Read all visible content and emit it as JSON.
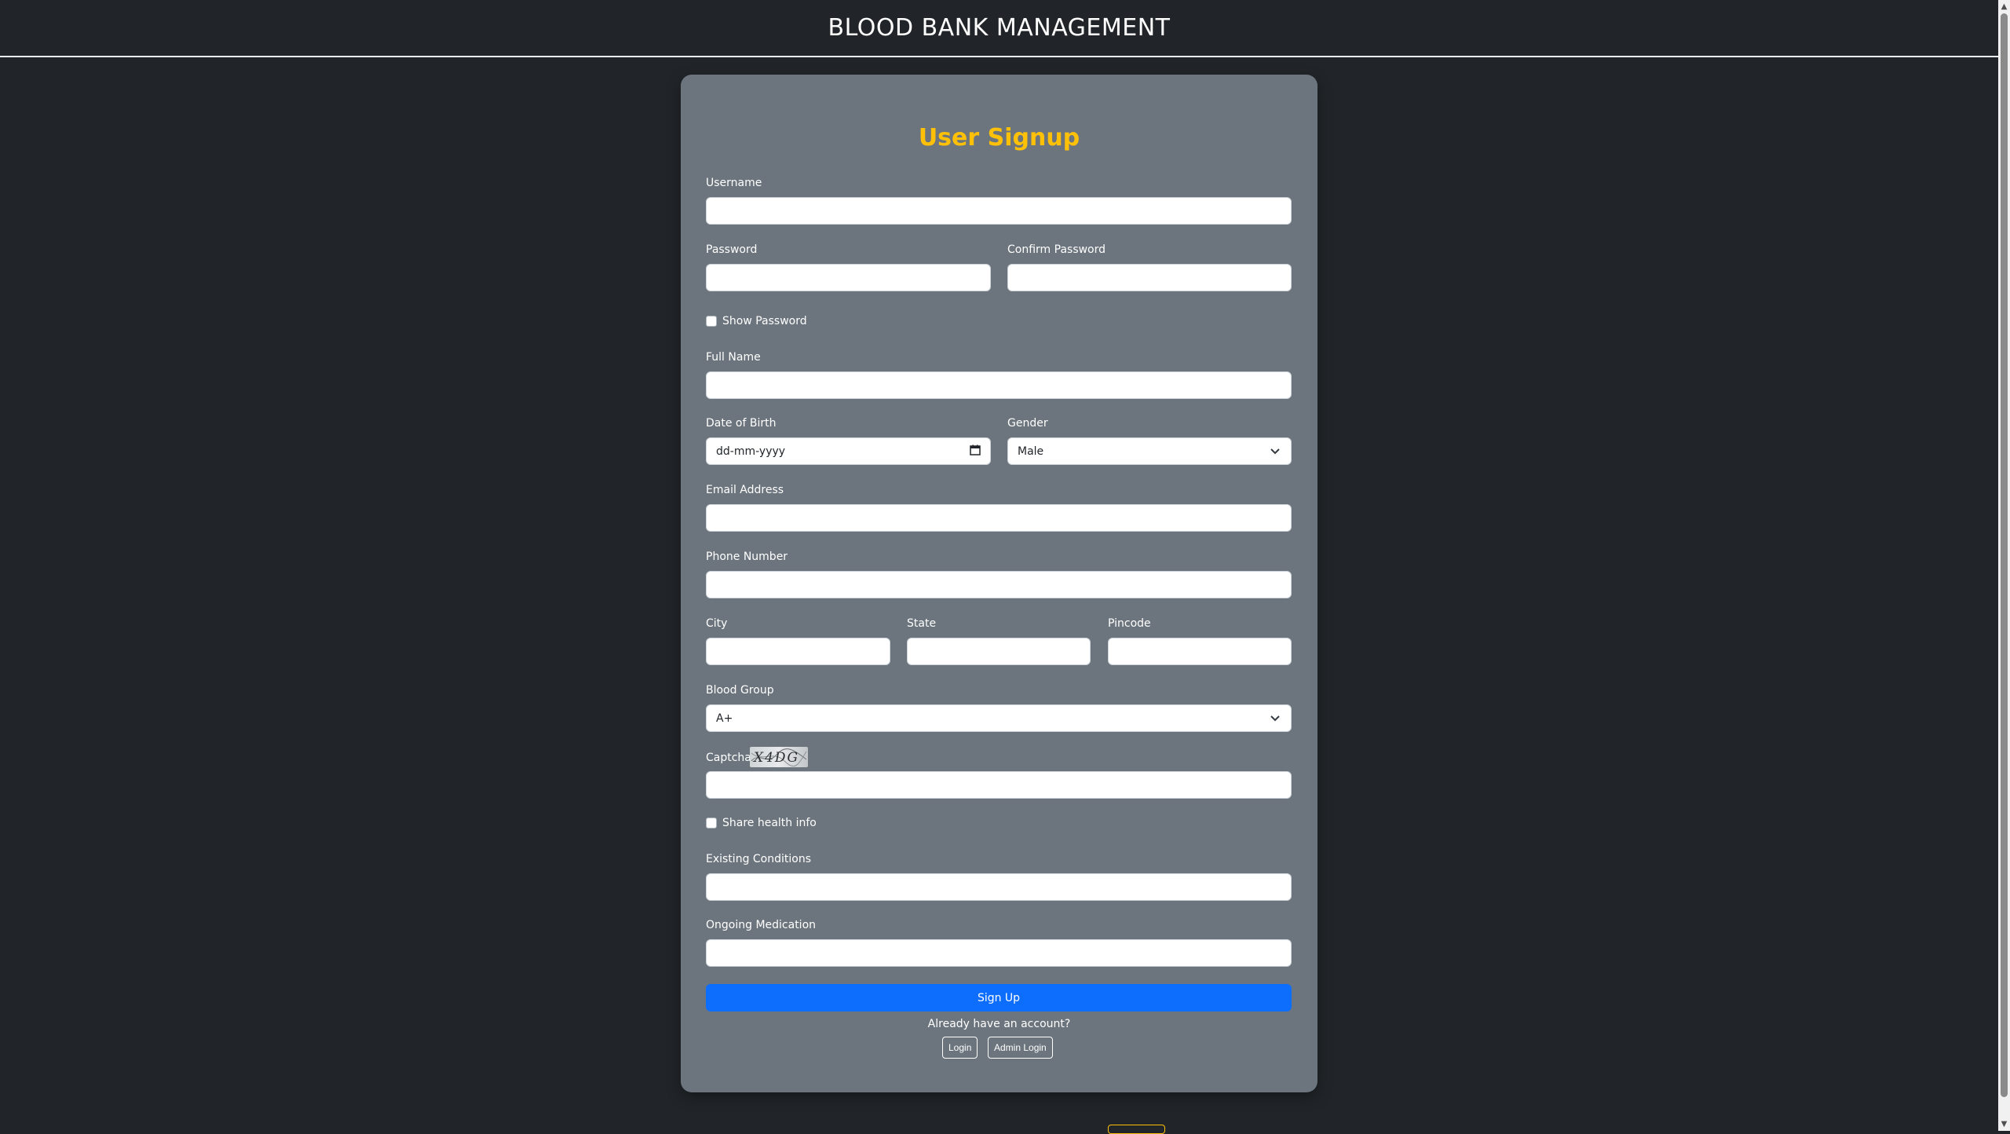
{
  "header": {
    "title": "BLOOD BANK MANAGEMENT"
  },
  "form": {
    "title": "User Signup",
    "username_label": "Username",
    "password_label": "Password",
    "confirm_password_label": "Confirm Password",
    "show_password_label": "Show Password",
    "fullname_label": "Full Name",
    "dob_label": "Date of Birth",
    "dob_placeholder": "dd-mm-yyyy",
    "gender_label": "Gender",
    "gender_value": "Male",
    "email_label": "Email Address",
    "phone_label": "Phone Number",
    "city_label": "City",
    "state_label": "State",
    "pincode_label": "Pincode",
    "blood_group_label": "Blood Group",
    "blood_group_value": "A+",
    "captcha_label": "Captcha",
    "captcha_text": "X4DG",
    "share_health_label": "Share health info",
    "conditions_label": "Existing Conditions",
    "medication_label": "Ongoing Medication",
    "signup_button": "Sign Up",
    "already_text": "Already have an account?",
    "login_button": "Login",
    "admin_login_button": "Admin Login"
  },
  "colors": {
    "background": "#212529",
    "card": "#6c757d",
    "title_accent": "#ffc107",
    "primary_button": "#0d6efd"
  }
}
